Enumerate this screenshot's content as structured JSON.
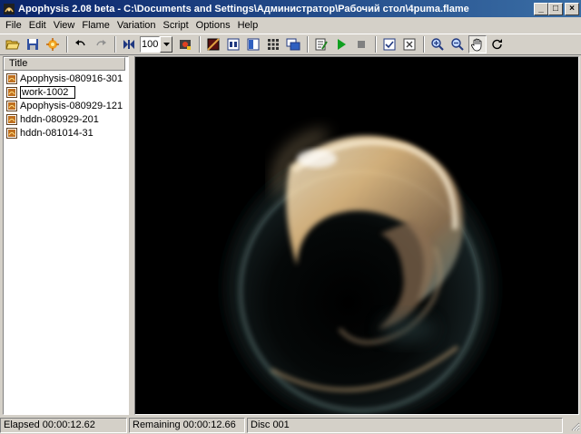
{
  "window": {
    "title": "Apophysis 2.08 beta - C:\\Documents and Settings\\Администратор\\Рабочий стол\\4puma.flame",
    "controls": [
      "_",
      "□",
      "×"
    ]
  },
  "menu": [
    "File",
    "Edit",
    "View",
    "Flame",
    "Variation",
    "Script",
    "Options",
    "Help"
  ],
  "toolbar": {
    "zoom_value": "100",
    "buttons": [
      "open-icon",
      "save-icon",
      "random-icon",
      "undo-icon",
      "redo-icon",
      "full-image-icon",
      "render-icon",
      "gradient-icon",
      "mutation-icon",
      "adjust-icon",
      "favorites-icon",
      "fullscreen-icon",
      "editor-icon",
      "play-script-icon",
      "stop-script-icon",
      "trace-icon",
      "reset-icon",
      "zoom-in-icon",
      "zoom-out-icon",
      "pan-hand-icon",
      "rotate-icon"
    ]
  },
  "flames": {
    "column_header": "Title",
    "items": [
      "Apophysis-080916-301",
      "work-1002",
      "Apophysis-080929-121",
      "hddn-080929-201",
      "hddn-081014-31"
    ],
    "editing_index": 1
  },
  "status": {
    "elapsed": "Elapsed 00:00:12.62",
    "remaining": "Remaining 00:00:12.66",
    "disc": "Disc 001"
  },
  "colors": {
    "titlebar_start": "#0a246a",
    "titlebar_end": "#3a6ea5",
    "face": "#d4d0c8",
    "flame_glow": "#f6d7a0",
    "flame_teal": "#5b7e80"
  }
}
